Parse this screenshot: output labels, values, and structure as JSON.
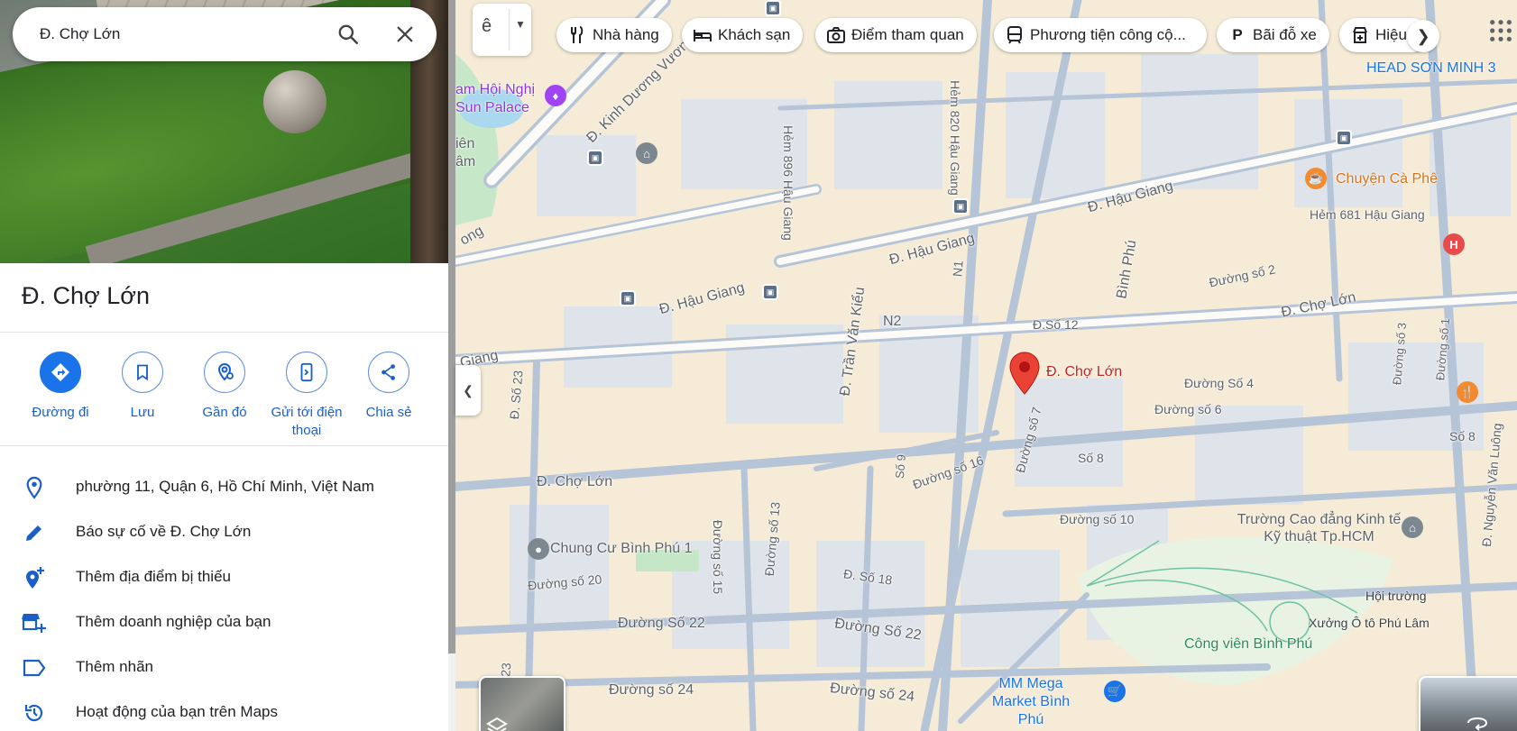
{
  "search": {
    "value": "Đ. Chợ Lớn"
  },
  "place": {
    "title": "Đ. Chợ Lớn"
  },
  "actions": [
    {
      "label": "Đường đi",
      "icon": "directions-icon"
    },
    {
      "label": "Lưu",
      "icon": "bookmark-icon"
    },
    {
      "label": "Gần đó",
      "icon": "nearby-icon"
    },
    {
      "label": "Gửi tới điện thoại",
      "icon": "send-to-phone-icon"
    },
    {
      "label": "Chia sẻ",
      "icon": "share-icon"
    }
  ],
  "details": [
    {
      "text": "phường 11, Quận 6, Hồ Chí Minh, Việt Nam",
      "icon": "location-pin-icon"
    },
    {
      "text": "Báo sự cố về Đ. Chợ Lớn",
      "icon": "edit-pencil-icon"
    },
    {
      "text": "Thêm địa điểm bị thiếu",
      "icon": "add-place-icon"
    },
    {
      "text": "Thêm doanh nghiệp của bạn",
      "icon": "add-business-icon"
    },
    {
      "text": "Thêm nhãn",
      "icon": "label-icon"
    },
    {
      "text": "Hoạt động của bạn trên Maps",
      "icon": "history-icon"
    }
  ],
  "map_type_toggle": {
    "glyph": "ê"
  },
  "chips": [
    {
      "label": "Nhà hàng",
      "icon": "restaurant-icon"
    },
    {
      "label": "Khách sạn",
      "icon": "hotel-icon"
    },
    {
      "label": "Điểm tham quan",
      "icon": "camera-icon"
    },
    {
      "label": "Phương tiện công cộ...",
      "icon": "transit-icon"
    },
    {
      "label": "Bãi đỗ xe",
      "icon": "parking-icon"
    },
    {
      "label": "Hiệu",
      "icon": "pharmacy-icon"
    }
  ],
  "colors": {
    "accent": "#1a73e8",
    "pin": "#ea4335",
    "poi_orange": "#f28b30",
    "park": "#c8e6c9"
  },
  "map": {
    "marker_label": "Đ. Chợ Lớn",
    "roads": [
      "Đ. Kinh Dương Vương",
      "Hẻm 820 Hậu Giang",
      "Hẻm 896 Hậu Giang",
      "Đ. Hậu Giang",
      "Đ. Hậu Giang",
      "Đ. Hậu Giang",
      "N1",
      "Bình Phú",
      "N2",
      "Đ. Trần Văn Kiểu",
      "Đ.Số 12",
      "Đường số 2",
      "Đ. Chợ Lớn",
      "Đường Số 4",
      "Đường số 6",
      "Đ. Số 23",
      "Đ. Chợ Lớn",
      "Đường số 16",
      "Đường số 7",
      "Số 8",
      "Số 9",
      "Đường số 10",
      "Đường số 13",
      "Đường số 15",
      "Đường số 20",
      "Đ. Số 18",
      "Đường Số 22",
      "Đường Số 22",
      "Đường số 24",
      "Đường số 24",
      "Hẻm 681 Hậu Giang",
      "Đường số 3",
      "Đường số 1",
      "Số 8",
      "Đ. Nguyễn Văn Luông",
      "Giang",
      "ong",
      "23"
    ],
    "places": [
      "HEAD SƠN MINH 3",
      "Chuyện Cà Phê",
      "Chung Cư Bình Phú 1",
      "Trường Cao đẳng Kinh tế Kỹ thuật Tp.HCM",
      "Hội trường",
      "Xưởng Ô tô Phú Lâm",
      "Công viên Bình Phú",
      "MM Mega Market Bình Phú",
      "am Hội Nghị Sun Palace",
      "iên âm"
    ]
  }
}
